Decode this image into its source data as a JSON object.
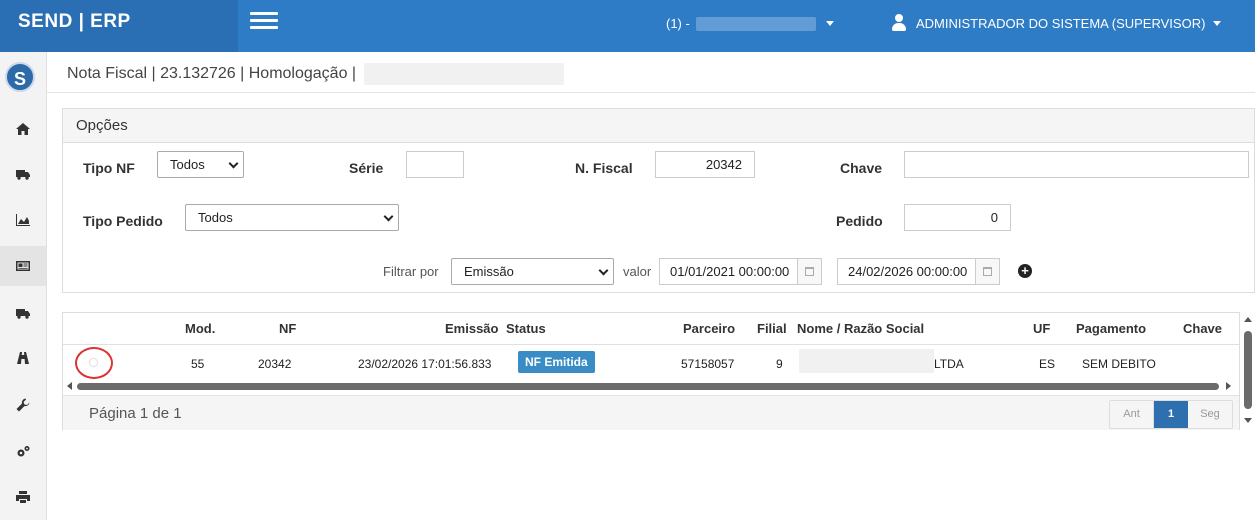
{
  "app": {
    "brand": "SEND | ERP"
  },
  "header": {
    "company_prefix": "(1) -",
    "user_label": "ADMINISTRADOR DO SISTEMA (SUPERVISOR)"
  },
  "sidebar": {
    "logo_letter": "S",
    "items": [
      {
        "icon": "home-icon"
      },
      {
        "icon": "truck-icon"
      },
      {
        "icon": "area-chart-icon"
      },
      {
        "icon": "newspaper-icon",
        "active": true
      },
      {
        "icon": "truck-icon"
      },
      {
        "icon": "road-icon"
      },
      {
        "icon": "wrench-icon"
      },
      {
        "icon": "gears-icon"
      },
      {
        "icon": "print-icon"
      }
    ]
  },
  "breadcrumb": {
    "text": "Nota Fiscal | 23.132726 | Homologação |"
  },
  "options": {
    "title": "Opções",
    "tipo_nf": {
      "label": "Tipo NF",
      "value": "Todos"
    },
    "serie": {
      "label": "Série",
      "value": ""
    },
    "n_fiscal": {
      "label": "N. Fiscal",
      "value": "20342"
    },
    "chave": {
      "label": "Chave",
      "value": ""
    },
    "tipo_pedido": {
      "label": "Tipo Pedido",
      "value": "Todos"
    },
    "pedido": {
      "label": "Pedido",
      "value": "0"
    },
    "filtrar_por": {
      "label": "Filtrar por",
      "value": "Emissão"
    },
    "valor": {
      "label": "valor",
      "from": "01/01/2021 00:00:00",
      "to": "24/02/2026 00:00:00"
    }
  },
  "grid": {
    "columns": [
      "Mod.",
      "NF",
      "Emissão",
      "Status",
      "Parceiro",
      "Filial",
      "Nome / Razão Social",
      "UF",
      "Pagamento",
      "Chave"
    ],
    "rows": [
      {
        "mod": "55",
        "nf": "20342",
        "emissao": "23/02/2026 17:01:56.833",
        "status": "NF Emitida",
        "parceiro": "57158057",
        "filial": "9",
        "nome_suffix": "LTDA",
        "uf": "ES",
        "pagamento": "SEM DEBITO",
        "chave": ""
      }
    ],
    "page_info": "Página 1 de 1",
    "pager": {
      "prev": "Ant",
      "current": "1",
      "next": "Seg"
    }
  },
  "colors": {
    "topbar": "#2e7bc6",
    "brand_bg": "#2a6fb4",
    "badge": "#3a8cc4",
    "highlight_circle": "#dd3333"
  }
}
